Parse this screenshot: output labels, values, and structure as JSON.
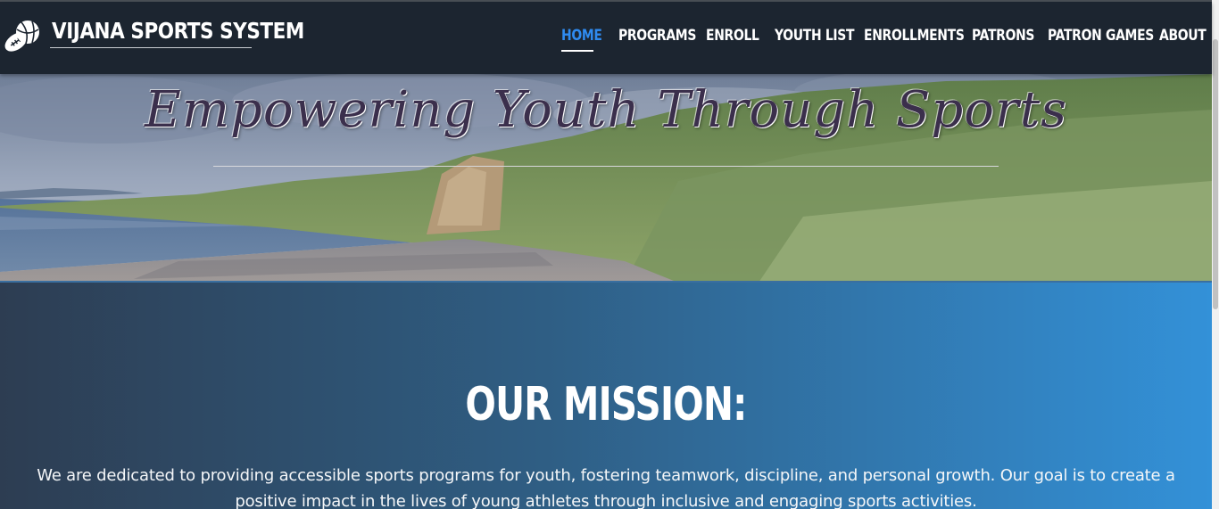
{
  "brand": {
    "name": "VIJANA SPORTS SYSTEM",
    "icon": "sports-balls-icon"
  },
  "nav": {
    "items": [
      {
        "label": "HOME",
        "active": true
      },
      {
        "label": "PROGRAMS",
        "active": false
      },
      {
        "label": "ENROLL",
        "active": false
      },
      {
        "label": "YOUTH LIST",
        "active": false
      },
      {
        "label": "ENROLLMENTS",
        "active": false
      },
      {
        "label": "PATRONS",
        "active": false
      },
      {
        "label": "PATRON GAMES",
        "active": false
      },
      {
        "label": "ABOUT",
        "active": false
      }
    ],
    "active_color": "#2f8bf0"
  },
  "hero": {
    "title": "Empowering Youth Through Sports",
    "image": "coastal-landscape-photo"
  },
  "mission": {
    "title": "OUR MISSION:",
    "text": "We are dedicated to providing accessible sports programs for youth, fostering teamwork, discipline, and personal growth. Our goal is to create a positive impact in the lives of young athletes through inclusive and engaging sports activities."
  },
  "colors": {
    "navbar_bg": "#1c2530",
    "mission_gradient_start": "#2d3d52",
    "mission_gradient_end": "#3391d8"
  }
}
